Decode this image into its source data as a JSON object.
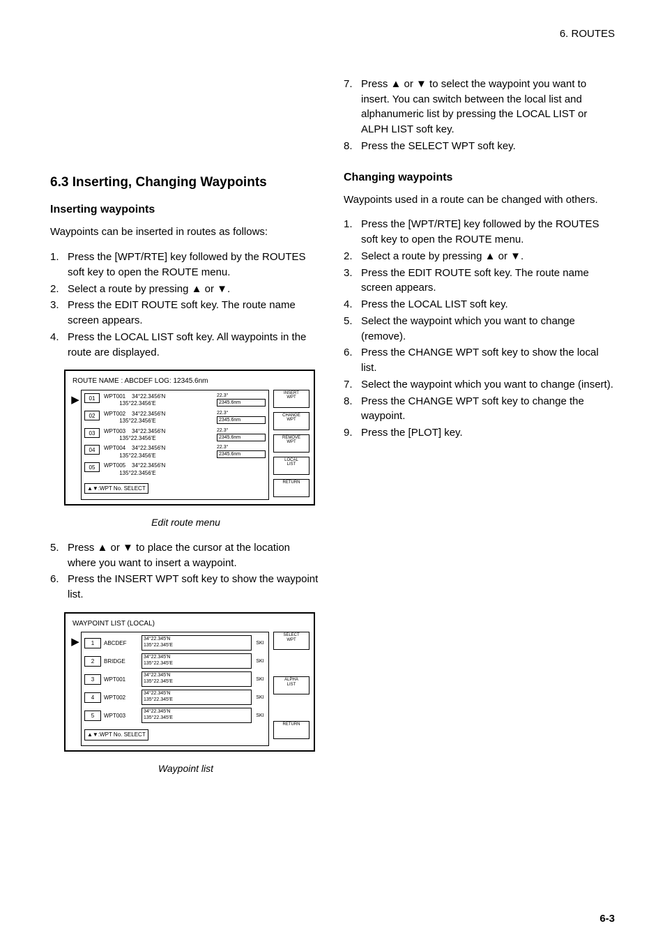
{
  "header": {
    "chapter": "6. ROUTES"
  },
  "left": {
    "h2": "6.3 Inserting, Changing Waypoints",
    "sub1_title": "Inserting waypoints",
    "sub1_intro": "Waypoints can be inserted in routes as follows:",
    "sub1_steps": [
      "Press the [WPT/RTE] key followed by the ROUTES soft key to open the ROUTE menu.",
      "Select a route by pressing ▲ or ▼.",
      "Press the EDIT ROUTE soft key. The route name screen appears.",
      "Press the LOCAL LIST soft key. All waypoints in the route are displayed."
    ],
    "fig1": {
      "title": "ROUTE NAME : ABCDEF                                 LOG: 12345.6nm",
      "rows": [
        {
          "n": "01",
          "name": "WPT001",
          "lat": "34°22.3456'N",
          "lon": "135°22.3456'E",
          "d": "22.3°",
          "dd": "2345.6nm"
        },
        {
          "n": "02",
          "name": "WPT002",
          "lat": "34°22.3456'N",
          "lon": "135°22.3456'E",
          "d": "22.3°",
          "dd": "2345.6nm"
        },
        {
          "n": "03",
          "name": "WPT003",
          "lat": "34°22.3456'N",
          "lon": "135°22.3456'E",
          "d": "22.3°",
          "dd": "2345.6nm"
        },
        {
          "n": "04",
          "name": "WPT004",
          "lat": "34°22.3456'N",
          "lon": "135°22.3456'E",
          "d": "22.3°",
          "dd": "2345.6nm"
        },
        {
          "n": "05",
          "name": "WPT005",
          "lat": "34°22.3456'N",
          "lon": "135°22.3456'E",
          "d": "",
          "dd": ""
        }
      ],
      "side": [
        "INSERT\nWPT",
        "CHANGE\nWPT",
        "REMOVE\nWPT",
        "LOCAL\nLIST",
        "RETURN"
      ],
      "foot": "▲▼:WPT No. SELECT",
      "caption": "Edit route menu"
    },
    "sub1_steps_after": [
      "Press ▲ or ▼ to place the cursor at the location where you want to insert a waypoint.",
      "Press the INSERT WPT soft key to show the waypoint list."
    ],
    "fig2": {
      "title": "WAYPOINT LIST (LOCAL)",
      "rows": [
        {
          "i": "1",
          "name": "ABCDEF",
          "c": "34°22.345'N\n135°22.345'E",
          "s": "SKI"
        },
        {
          "i": "2",
          "name": "BRIDGE",
          "c": "34°22.345'N\n135°22.345'E",
          "s": "SKI"
        },
        {
          "i": "3",
          "name": "WPT001",
          "c": "34°22.345'N\n135°22.345'E",
          "s": "SKI"
        },
        {
          "i": "4",
          "name": "WPT002",
          "c": "34°22.345'N\n135°22.345'E",
          "s": "SKI"
        },
        {
          "i": "5",
          "name": "WPT003",
          "c": "34°22.345'N\n135°22.345'E",
          "s": "SKI"
        }
      ],
      "side": [
        "SELECT\nWPT",
        "",
        "ALPHA\nLIST",
        "",
        "RETURN"
      ],
      "foot": "▲▼:WPT No. SELECT",
      "caption": "Waypoint list"
    }
  },
  "right": {
    "sub1_steps_cont": [
      "Press ▲ or ▼ to select the waypoint you want to insert. You can switch between the local list and alphanumeric list by pressing the LOCAL LIST or ALPH LIST soft key.",
      "Press the SELECT WPT soft key."
    ],
    "sub2_title": "Changing waypoints",
    "sub2_intro": "Waypoints used in a route can be changed with others.",
    "sub2_steps": [
      "Press the [WPT/RTE] key followed by the ROUTES soft key to open the ROUTE menu.",
      "Select a route by pressing ▲ or ▼.",
      "Press the EDIT ROUTE soft key. The route name screen appears.",
      "Press the LOCAL LIST soft key.",
      "Select the waypoint which you want to change (remove).",
      "Press the CHANGE WPT soft key to show the local list.",
      "Select the waypoint which you want to change (insert).",
      "Press the CHANGE WPT soft key to change the waypoint.",
      "Press the [PLOT] key."
    ]
  },
  "pagenum": "6-3"
}
